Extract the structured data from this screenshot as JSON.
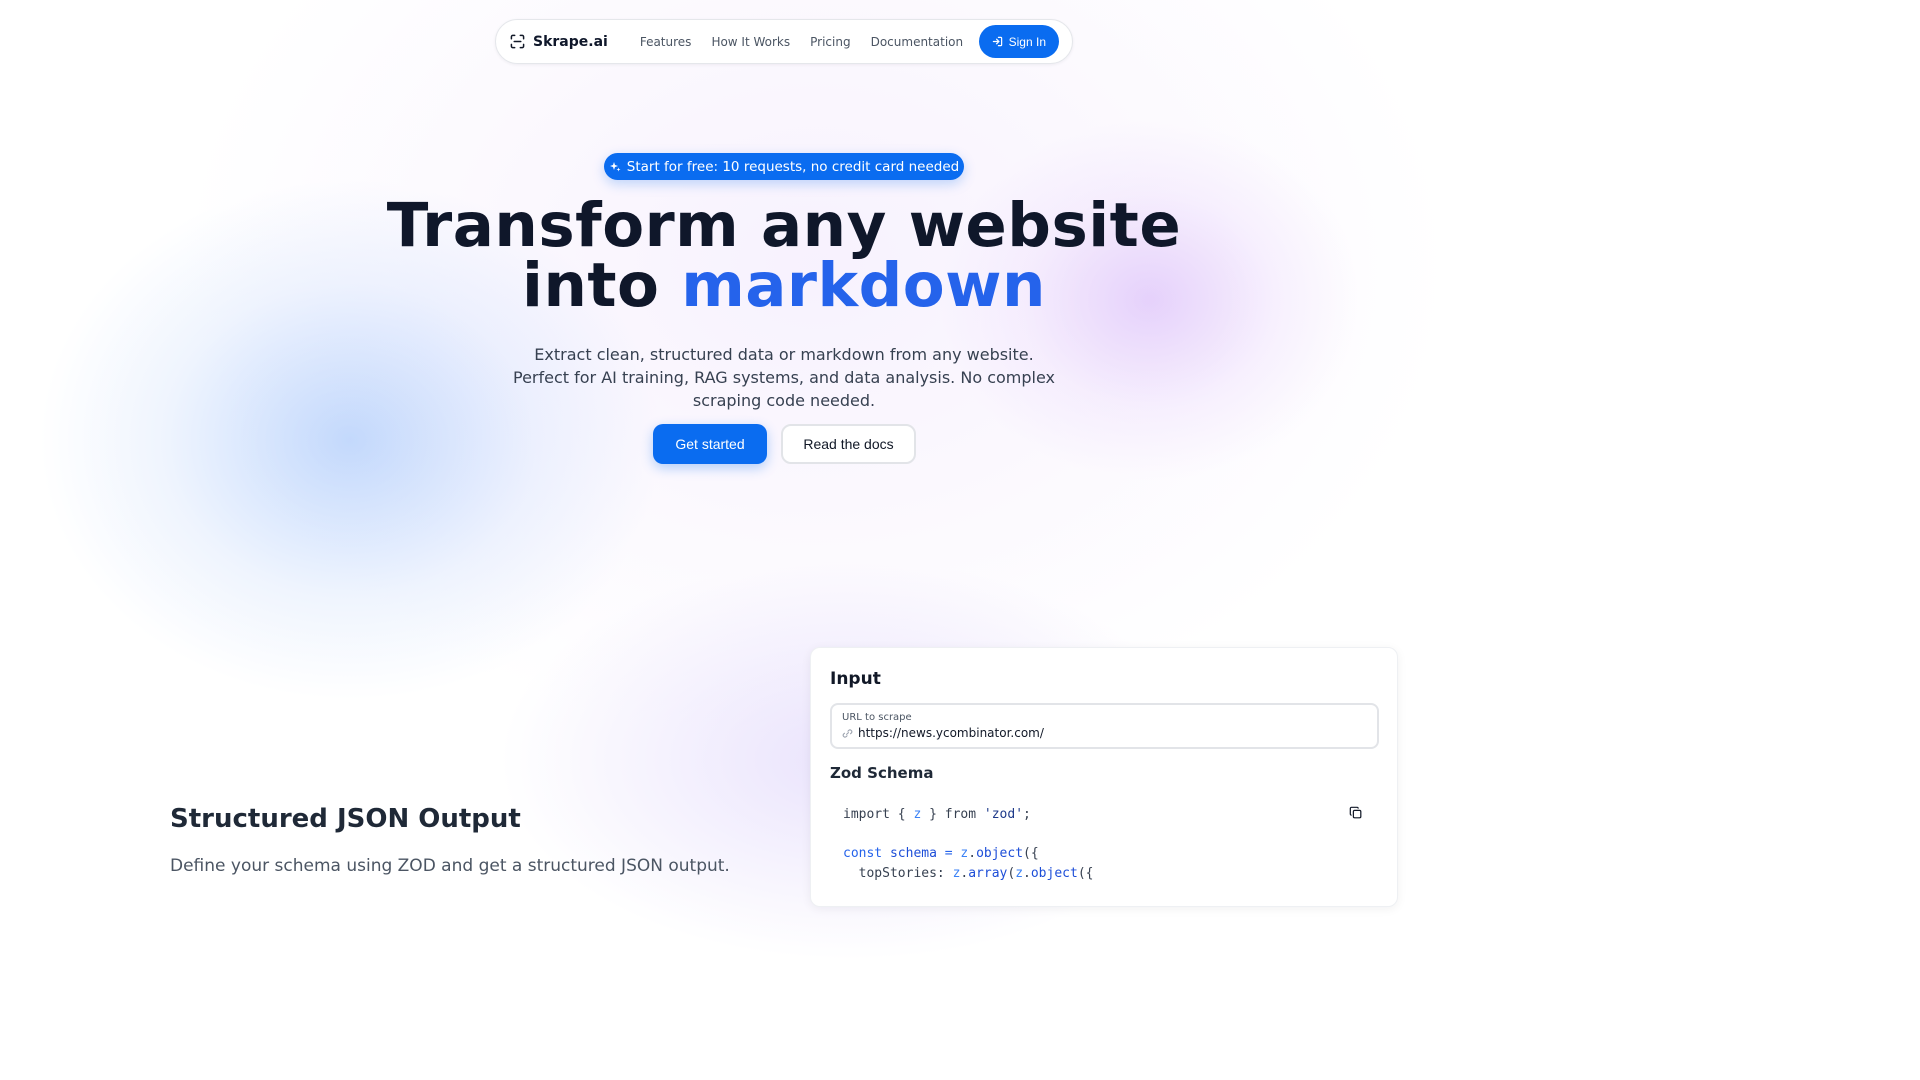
{
  "nav": {
    "brand": "Skrape.ai",
    "links": [
      "Features",
      "How It Works",
      "Pricing",
      "Documentation"
    ],
    "signin_label": "Sign In"
  },
  "hero": {
    "badge": "Start for free: 10 requests, no credit card needed",
    "headline_line1": "Transform any website",
    "headline_into": "into",
    "headline_accent": "markdown",
    "subtitle": "Extract clean, structured data or markdown from any website. Perfect for AI training, RAG systems, and data analysis. No complex scraping code needed.",
    "primary_cta": "Get started",
    "secondary_cta": "Read the docs"
  },
  "feature": {
    "title": "Structured JSON Output",
    "description": "Define your schema using ZOD and get a structured JSON output."
  },
  "input_card": {
    "title": "Input",
    "url_label": "URL to scrape",
    "url_value": "https://news.ycombinator.com/",
    "schema_title": "Zod Schema",
    "code": {
      "l1_import": "import",
      "l1_open": " { ",
      "l1_z": "z",
      "l1_close": " } ",
      "l1_from": "from",
      "l1_sp": " ",
      "l1_mod": "'zod'",
      "l1_semi": ";",
      "l3_const": "const",
      "l3_sp": " ",
      "l3_schema": "schema",
      "l3_eq": " = ",
      "l3_z": "z",
      "l3_dot": ".",
      "l3_object": "object",
      "l3_paren": "({",
      "l4_key": "  topStories: ",
      "l4_z1": "z",
      "l4_dot1": ".",
      "l4_array": "array",
      "l4_p1": "(",
      "l4_z2": "z",
      "l4_dot2": ".",
      "l4_object": "object",
      "l4_p2": "({"
    }
  },
  "colors": {
    "primary": "#0a6cf0",
    "accent_text": "#2563eb",
    "heading": "#0f172a"
  }
}
